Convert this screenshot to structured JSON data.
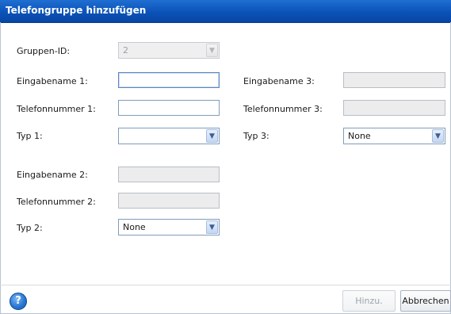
{
  "dialog": {
    "title": "Telefongruppe hinzufügen"
  },
  "group": {
    "label": "Gruppen-ID:",
    "value": "2"
  },
  "entries": [
    {
      "name_label": "Eingabename 1:",
      "name_value": "",
      "phone_label": "Telefonnummer 1:",
      "phone_value": "",
      "type_label": "Typ 1:",
      "type_value": ""
    },
    {
      "name_label": "Eingabename 2:",
      "name_value": "",
      "phone_label": "Telefonnummer 2:",
      "phone_value": "",
      "type_label": "Typ 2:",
      "type_value": "None"
    },
    {
      "name_label": "Eingabename 3:",
      "name_value": "",
      "phone_label": "Telefonnummer 3:",
      "phone_value": "",
      "type_label": "Typ 3:",
      "type_value": "None"
    }
  ],
  "footer": {
    "help_icon": "?",
    "add_label": "Hinzu.",
    "cancel_label": "Abbrechen"
  },
  "icons": {
    "help": "help-icon",
    "dropdown": "chevron-down-icon"
  },
  "colors": {
    "titlebar": "#0b52b8",
    "field_border": "#7f9db9",
    "disabled_field": "#ececec"
  }
}
